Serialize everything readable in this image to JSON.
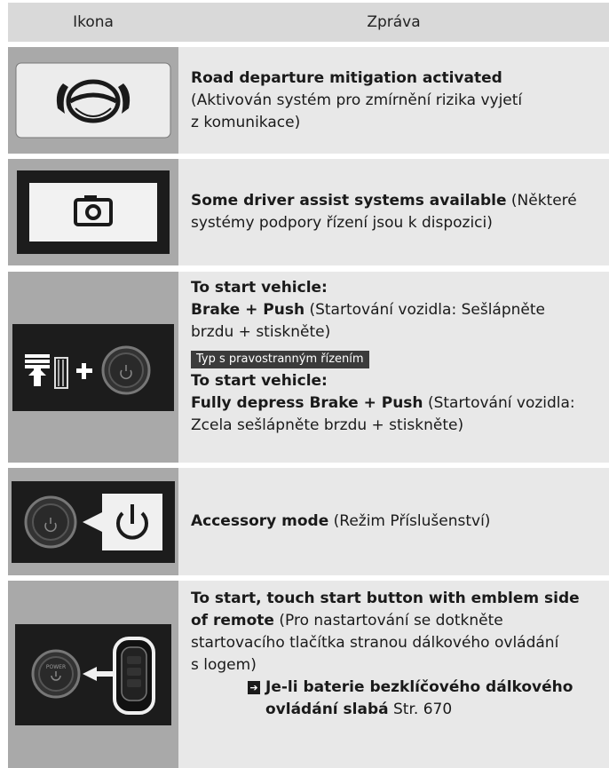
{
  "header": {
    "icon_col": "Ikona",
    "message_col": "Zpráva"
  },
  "rows": [
    {
      "icon": "road-departure-steering-icon",
      "title": "Road departure mitigation activated",
      "desc": "(Aktivován systém pro zmírnění rizika vyjetí",
      "desc2": "z komunikace)"
    },
    {
      "icon": "camera-icon",
      "title": "Some driver assist systems available",
      "desc": "(Některé",
      "desc2": "systémy podpory řízení jsou k dispozici)"
    },
    {
      "icon": "brake-pedal-plus-power-button-icon",
      "title": "To start vehicle:",
      "line2_bold": "Brake + Push",
      "line2": "(Startování vozidla: Sešlápněte",
      "line3": "brzdu + stiskněte)",
      "tag": "Typ s pravostranným řízením",
      "title_b": "To start vehicle:",
      "line5_bold": "Fully depress Brake + Push",
      "line5": "(Startování vozidla:",
      "line6": "Zcela sešlápněte brzdu + stiskněte)"
    },
    {
      "icon": "power-button-accessory-icon",
      "title": "Accessory mode",
      "desc": "(Režim Příslušenství)"
    },
    {
      "icon": "power-button-remote-fob-icon",
      "title": "To start, touch start button with emblem side",
      "title2": "of remote",
      "desc": "(Pro nastartování se dotkněte",
      "desc2": "startovacího tlačítka stranou dálkového ovládání",
      "desc3": "s logem)",
      "ref_bold": "Je-li baterie bezklíčového dálkového",
      "ref_bold2": "ovládání slabá",
      "ref_page": "Str. 670",
      "power_label": "POWER"
    }
  ]
}
